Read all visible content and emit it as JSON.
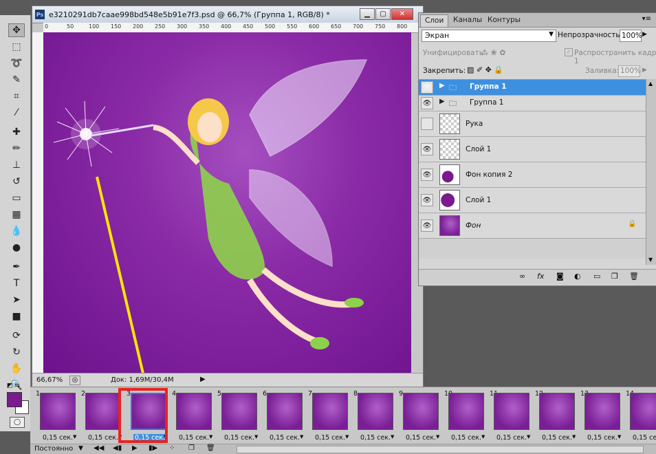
{
  "document": {
    "title": "e3210291db7caae998bd548e5b91e7f3.psd @ 66,7% (Группа 1, RGB/8) *",
    "ps_badge": "Ps",
    "ruler_ticks": [
      "0",
      "50",
      "100",
      "150",
      "200",
      "250",
      "300",
      "350",
      "400",
      "450",
      "500",
      "550",
      "600",
      "650",
      "700",
      "750",
      "800"
    ],
    "zoom": "66,67%",
    "doc_info": "Док: 1,69M/30,4M"
  },
  "layers_panel": {
    "tabs": [
      "Слои",
      "Каналы",
      "Контуры"
    ],
    "blend_mode": "Экран",
    "opacity_label": "Непрозрачность:",
    "opacity_value": "100%",
    "unify_label": "Унифицировать:",
    "propagate_label": "Распространить кадр 1",
    "lock_label": "Закрепить:",
    "fill_label": "Заливка:",
    "fill_value": "100%",
    "layers": [
      {
        "name": "Группа 1",
        "type": "group",
        "visible": true,
        "selected": true
      },
      {
        "name": "Группа 1",
        "type": "group",
        "visible": true,
        "selected": false
      },
      {
        "name": "Рука",
        "type": "layer",
        "visible": false,
        "selected": false
      },
      {
        "name": "Слой 1",
        "type": "layer",
        "visible": true,
        "selected": false
      },
      {
        "name": "Фон копия 2",
        "type": "layer",
        "visible": true,
        "selected": false
      },
      {
        "name": "Слой 1",
        "type": "layer",
        "visible": true,
        "selected": false
      },
      {
        "name": "Фон",
        "type": "background",
        "visible": true,
        "selected": false,
        "locked": true
      }
    ]
  },
  "timeline": {
    "frames": [
      {
        "num": "1",
        "duration": "0,15 сек."
      },
      {
        "num": "2",
        "duration": "0,15 сек."
      },
      {
        "num": "3",
        "duration": "0,15 сек.",
        "selected": true
      },
      {
        "num": "4",
        "duration": "0,15 сек."
      },
      {
        "num": "5",
        "duration": "0,15 сек."
      },
      {
        "num": "6",
        "duration": "0,15 сек."
      },
      {
        "num": "7",
        "duration": "0,15 сек."
      },
      {
        "num": "8",
        "duration": "0,15 сек."
      },
      {
        "num": "9",
        "duration": "0,15 сек."
      },
      {
        "num": "10",
        "duration": "0,15 сек."
      },
      {
        "num": "11",
        "duration": "0,15 сек."
      },
      {
        "num": "12",
        "duration": "0,15 сек."
      },
      {
        "num": "13",
        "duration": "0,15 сек."
      },
      {
        "num": "14",
        "duration": "0,15 сек."
      }
    ],
    "loop_mode": "Постоянно"
  },
  "colors": {
    "foreground": "#7a1a8c",
    "background": "#ffffff",
    "highlight_box": "#e8231f",
    "annotation_line": "#ffe600",
    "selection": "#3d8fe0"
  }
}
